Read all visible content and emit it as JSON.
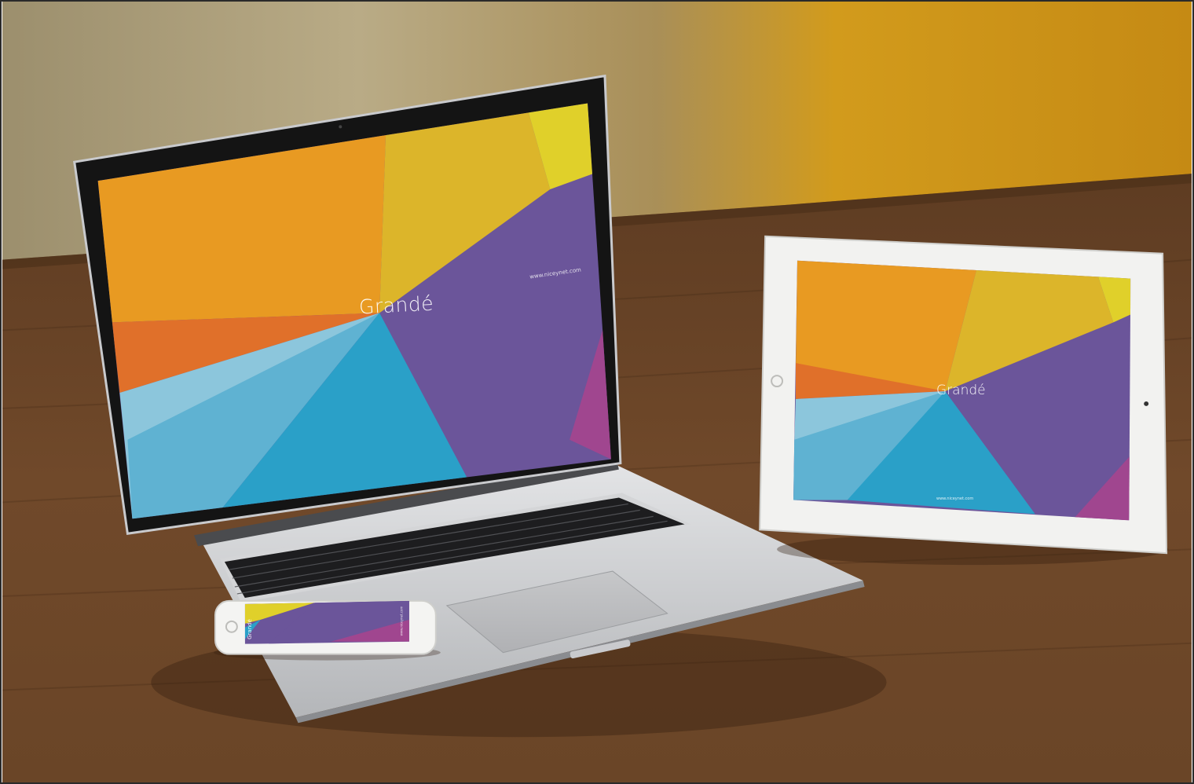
{
  "scene": {
    "description_tag": "device-mockup",
    "colors": {
      "wall_left": "#b8aa86",
      "wall_right": "#cf9a1e",
      "table": "#6a4527",
      "orange": "#e89a22",
      "dark_orange": "#e0702a",
      "yellow": "#dcb52a",
      "lime": "#e0d02a",
      "purple": "#6b559a",
      "blue": "#2aa0c8",
      "light_blue": "#8cc6dc",
      "magenta": "#a0468f"
    }
  },
  "laptop": {
    "brand": "Grandé",
    "url": "www.niceynet.com"
  },
  "tablet": {
    "brand": "Grandé",
    "url": "www.niceynet.com"
  },
  "phone": {
    "brand": "Grandé",
    "url": "www.niceynet.com"
  }
}
